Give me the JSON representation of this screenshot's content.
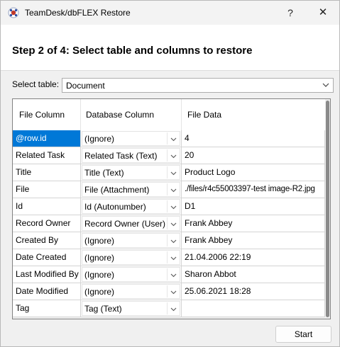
{
  "window": {
    "title": "TeamDesk/dbFLEX Restore",
    "help_label": "?",
    "close_label": "✕"
  },
  "header": {
    "step_title": "Step 2 of 4: Select table and columns to restore"
  },
  "table_select": {
    "label": "Select table:",
    "value": "Document"
  },
  "grid": {
    "columns": [
      "File Column",
      "Database Column",
      "File Data"
    ],
    "rows": [
      {
        "file_column": "@row.id",
        "database_column": "(Ignore)",
        "file_data": "4"
      },
      {
        "file_column": "Related Task",
        "database_column": "Related Task (Text)",
        "file_data": "20"
      },
      {
        "file_column": "Title",
        "database_column": "Title (Text)",
        "file_data": "Product Logo"
      },
      {
        "file_column": "File",
        "database_column": "File (Attachment)",
        "file_data": "./files/r4c55003397-test image-R2.jpg"
      },
      {
        "file_column": "Id",
        "database_column": "Id (Autonumber)",
        "file_data": "D1"
      },
      {
        "file_column": "Record Owner",
        "database_column": "Record Owner (User)",
        "file_data": "Frank Abbey"
      },
      {
        "file_column": "Created By",
        "database_column": "(Ignore)",
        "file_data": "Frank Abbey"
      },
      {
        "file_column": "Date Created",
        "database_column": "(Ignore)",
        "file_data": "21.04.2006 22:19"
      },
      {
        "file_column": "Last Modified By",
        "database_column": "(Ignore)",
        "file_data": "Sharon Abbot"
      },
      {
        "file_column": "Date Modified",
        "database_column": "(Ignore)",
        "file_data": "25.06.2021 18:28"
      },
      {
        "file_column": "Tag",
        "database_column": "Tag (Text)",
        "file_data": ""
      }
    ]
  },
  "footer": {
    "start_label": "Start"
  },
  "colors": {
    "selection": "#0078d7",
    "window_bg": "#f0f0f0"
  }
}
